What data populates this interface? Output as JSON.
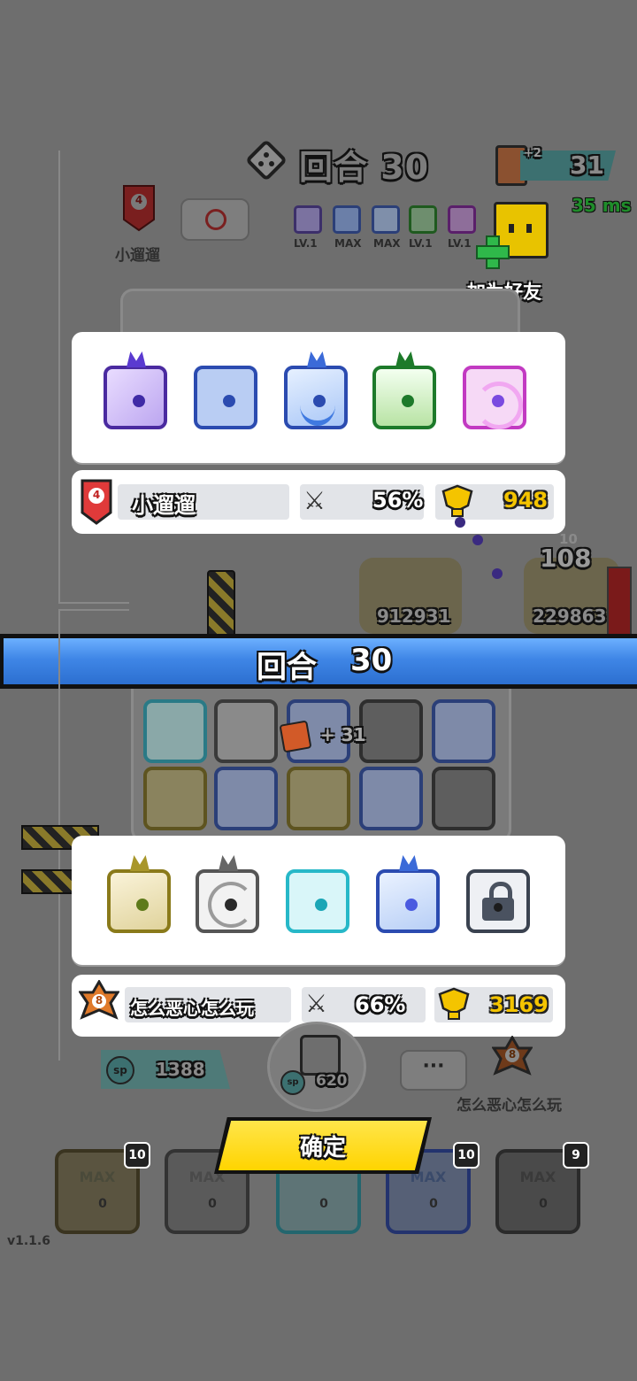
{
  "top": {
    "round_label": "回合 30",
    "card_count": "31",
    "card_plus": "+2",
    "ping": "35 ms",
    "player_name": "小遛遛",
    "player_rank": "4",
    "add_friend": "加为好友",
    "mini_levels": [
      "LV.1",
      "MAX",
      "MAX",
      "LV.1",
      "LV.1"
    ]
  },
  "banner": {
    "round_word": "回合",
    "round_num": "30"
  },
  "panel1": {
    "rank": "4",
    "name": "小遛遛",
    "crit": "56%",
    "gold": "948"
  },
  "panel2": {
    "rank": "8",
    "name": "怎么恶心怎么玩",
    "crit": "66%",
    "gold": "3169"
  },
  "battle": {
    "hp_left": "912931",
    "hp_right": "229863",
    "damage_big": "108",
    "damage_small": "10",
    "card_gain": "+ 31"
  },
  "bottom": {
    "sp_total": "1388",
    "sp_cost": "620",
    "sp_label": "sp",
    "chat_dots": "···",
    "opponent_rank": "8",
    "opponent_name": "怎么恶心怎么玩",
    "confirm": "确定",
    "version": "v1.1.6",
    "slots": [
      {
        "label": "MAX",
        "count": "10",
        "sp": "0"
      },
      {
        "label": "MAX",
        "count": "",
        "sp": "0"
      },
      {
        "label": "",
        "count": "",
        "sp": "0"
      },
      {
        "label": "MAX",
        "count": "10",
        "sp": "0"
      },
      {
        "label": "MAX",
        "count": "9",
        "sp": "0"
      }
    ]
  },
  "colors": {
    "banner_blue": "#3f86e6",
    "confirm_yellow": "#ffd400",
    "ping_green": "#1f8c2a",
    "crown_gold": "#f4c400"
  }
}
